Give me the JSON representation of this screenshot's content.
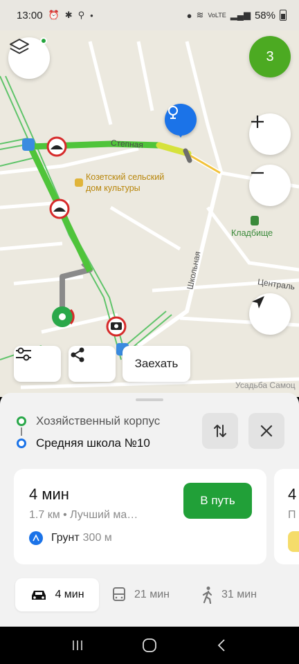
{
  "status_bar": {
    "time": "13:00",
    "battery": "58%",
    "net": "VoLTE"
  },
  "map": {
    "streets": {
      "stepnaya": "Степная",
      "shkolnaya": "Школьная",
      "centralnaya": "Централь",
      "usadba": "Усадьба Самоц"
    },
    "poi": {
      "culture_house_line1": "Козетский сельский",
      "culture_house_line2": "дом культуры",
      "cemetery": "Кладбище"
    },
    "route_count": "3"
  },
  "map_controls": {
    "stop_label": "Заехать"
  },
  "route": {
    "from": "Хозяйственный корпус",
    "to": "Средняя школа №10"
  },
  "card": {
    "time": "4 мин",
    "subtitle": "1.7 км • Лучший ма…",
    "go_label": "В путь",
    "surface_label": "Грунт",
    "surface_distance": "300 м"
  },
  "card2": {
    "time": "4",
    "subtitle": "П"
  },
  "modes": {
    "car": "4 мин",
    "bus": "21 мин",
    "walk": "31 мин"
  },
  "colors": {
    "route_green": "#4fc43a",
    "go_button": "#21a038",
    "accent_blue": "#1b73e8",
    "count_badge": "#4caa22"
  }
}
